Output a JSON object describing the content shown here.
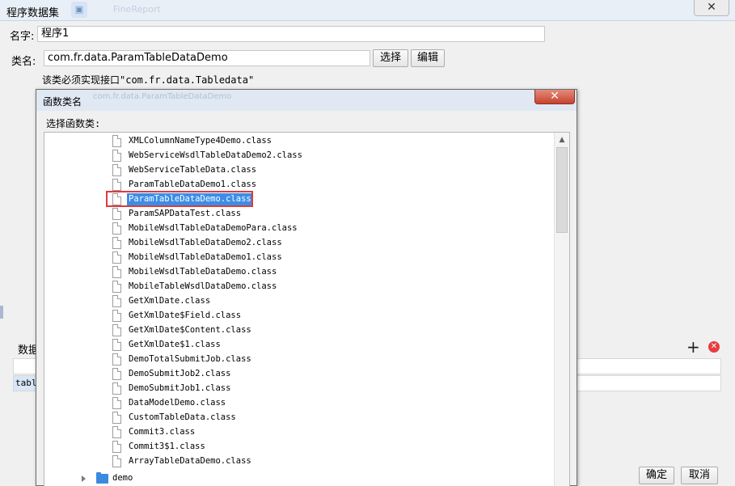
{
  "outer_dialog": {
    "title": "程序数据集",
    "title_ghost": "FineReport",
    "close_glyph": "✕",
    "name_label": "名字:",
    "name_value": "程序1",
    "class_label": "类名:",
    "class_value": "com.fr.data.ParamTableDataDemo",
    "select_button": "选择",
    "edit_button": "编辑",
    "hint": "该类必须实现接口\"com.fr.data.Tabledata\"",
    "data_section_label": "数据",
    "table_cell_partial": "table",
    "add_glyph": "+",
    "remove_glyph": "✕",
    "ok_button": "确定",
    "cancel_button": "取消"
  },
  "inner_dialog": {
    "title": "函数类名",
    "title_ghost": "com.fr.data.ParamTableDataDemo",
    "close_glyph": "✕",
    "choose_label": "选择函数类:",
    "files": [
      "XMLColumnNameType4Demo.class",
      "WebServiceWsdlTableDataDemo2.class",
      "WebServiceTableData.class",
      "ParamTableDataDemo1.class",
      "ParamTableDataDemo.class",
      "ParamSAPDataTest.class",
      "MobileWsdlTableDataDemoPara.class",
      "MobileWsdlTableDataDemo2.class",
      "MobileWsdlTableDataDemo1.class",
      "MobileWsdlTableDataDemo.class",
      "MobileTableWsdlDataDemo.class",
      "GetXmlDate.class",
      "GetXmlDate$Field.class",
      "GetXmlDate$Content.class",
      "GetXmlDate$1.class",
      "DemoTotalSubmitJob.class",
      "DemoSubmitJob2.class",
      "DemoSubmitJob1.class",
      "DataModelDemo.class",
      "CustomTableData.class",
      "Commit3.class",
      "Commit3$1.class",
      "ArrayTableDataDemo.class"
    ],
    "selected_index": 4,
    "folder_name": "demo",
    "scroll_up_glyph": "▲"
  },
  "colors": {
    "selection_fill": "#3b8ee8",
    "highlight_box": "#e03a3a",
    "folder": "#3a8ae0",
    "remove_icon": "#e53e3e"
  }
}
